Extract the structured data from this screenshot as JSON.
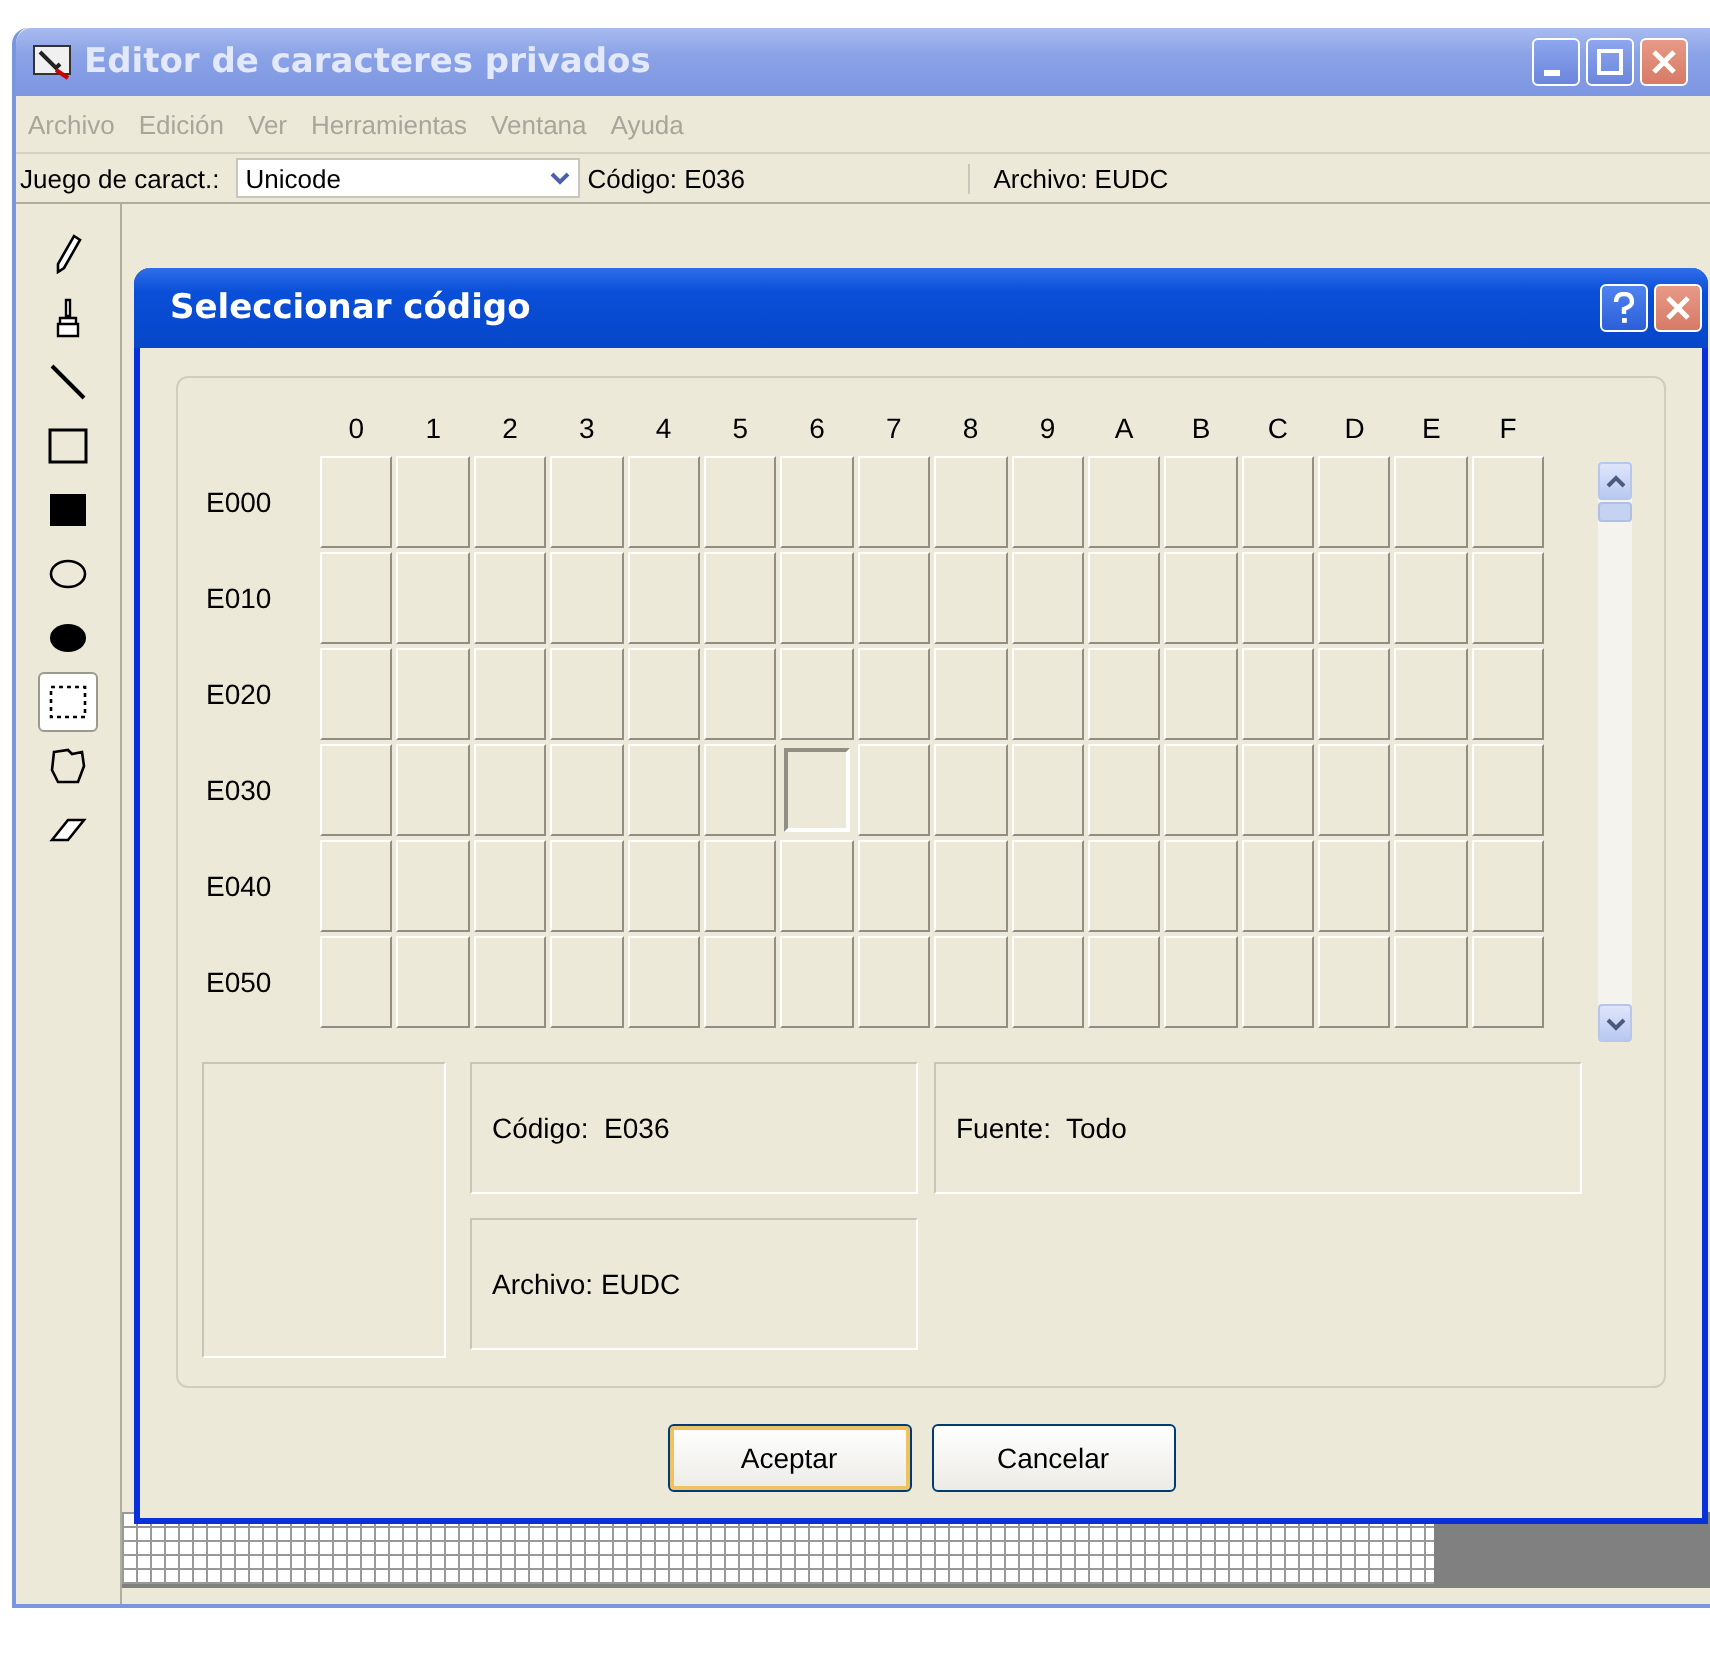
{
  "window": {
    "title": "Editor de caracteres privados"
  },
  "menu": [
    "Archivo",
    "Edición",
    "Ver",
    "Herramientas",
    "Ventana",
    "Ayuda"
  ],
  "toolbar": {
    "charset_label": "Juego de caract.:",
    "charset_value": "Unicode",
    "code": "Código: E036",
    "file": "Archivo: EUDC"
  },
  "tools": [
    {
      "kind": "pencil",
      "selected": false
    },
    {
      "kind": "brush",
      "selected": false
    },
    {
      "kind": "line",
      "selected": false
    },
    {
      "kind": "rect",
      "selected": false
    },
    {
      "kind": "filled-rect",
      "selected": false
    },
    {
      "kind": "ellipse",
      "selected": false
    },
    {
      "kind": "filled-ellipse",
      "selected": false
    },
    {
      "kind": "rect-select",
      "selected": true
    },
    {
      "kind": "free-select",
      "selected": false
    },
    {
      "kind": "eraser",
      "selected": false
    }
  ],
  "dialog": {
    "title": "Seleccionar código",
    "columns": [
      "0",
      "1",
      "2",
      "3",
      "4",
      "5",
      "6",
      "7",
      "8",
      "9",
      "A",
      "B",
      "C",
      "D",
      "E",
      "F"
    ],
    "rows": [
      {
        "label": "E000",
        "cells": [
          {
            "selected": false
          },
          {
            "selected": false
          },
          {
            "selected": false
          },
          {
            "selected": false
          },
          {
            "selected": false
          },
          {
            "selected": false
          },
          {
            "selected": false
          },
          {
            "selected": false
          },
          {
            "selected": false
          },
          {
            "selected": false
          },
          {
            "selected": false
          },
          {
            "selected": false
          },
          {
            "selected": false
          },
          {
            "selected": false
          },
          {
            "selected": false
          },
          {
            "selected": false
          }
        ]
      },
      {
        "label": "E010",
        "cells": [
          {
            "selected": false
          },
          {
            "selected": false
          },
          {
            "selected": false
          },
          {
            "selected": false
          },
          {
            "selected": false
          },
          {
            "selected": false
          },
          {
            "selected": false
          },
          {
            "selected": false
          },
          {
            "selected": false
          },
          {
            "selected": false
          },
          {
            "selected": false
          },
          {
            "selected": false
          },
          {
            "selected": false
          },
          {
            "selected": false
          },
          {
            "selected": false
          },
          {
            "selected": false
          }
        ]
      },
      {
        "label": "E020",
        "cells": [
          {
            "selected": false
          },
          {
            "selected": false
          },
          {
            "selected": false
          },
          {
            "selected": false
          },
          {
            "selected": false
          },
          {
            "selected": false
          },
          {
            "selected": false
          },
          {
            "selected": false
          },
          {
            "selected": false
          },
          {
            "selected": false
          },
          {
            "selected": false
          },
          {
            "selected": false
          },
          {
            "selected": false
          },
          {
            "selected": false
          },
          {
            "selected": false
          },
          {
            "selected": false
          }
        ]
      },
      {
        "label": "E030",
        "cells": [
          {
            "selected": false
          },
          {
            "selected": false
          },
          {
            "selected": false
          },
          {
            "selected": false
          },
          {
            "selected": false
          },
          {
            "selected": false
          },
          {
            "selected": true
          },
          {
            "selected": false
          },
          {
            "selected": false
          },
          {
            "selected": false
          },
          {
            "selected": false
          },
          {
            "selected": false
          },
          {
            "selected": false
          },
          {
            "selected": false
          },
          {
            "selected": false
          },
          {
            "selected": false
          }
        ]
      },
      {
        "label": "E040",
        "cells": [
          {
            "selected": false
          },
          {
            "selected": false
          },
          {
            "selected": false
          },
          {
            "selected": false
          },
          {
            "selected": false
          },
          {
            "selected": false
          },
          {
            "selected": false
          },
          {
            "selected": false
          },
          {
            "selected": false
          },
          {
            "selected": false
          },
          {
            "selected": false
          },
          {
            "selected": false
          },
          {
            "selected": false
          },
          {
            "selected": false
          },
          {
            "selected": false
          },
          {
            "selected": false
          }
        ]
      },
      {
        "label": "E050",
        "cells": [
          {
            "selected": false
          },
          {
            "selected": false
          },
          {
            "selected": false
          },
          {
            "selected": false
          },
          {
            "selected": false
          },
          {
            "selected": false
          },
          {
            "selected": false
          },
          {
            "selected": false
          },
          {
            "selected": false
          },
          {
            "selected": false
          },
          {
            "selected": false
          },
          {
            "selected": false
          },
          {
            "selected": false
          },
          {
            "selected": false
          },
          {
            "selected": false
          },
          {
            "selected": false
          }
        ]
      }
    ],
    "code": "Código:  E036",
    "font": "Fuente:  Todo",
    "file": "Archivo: EUDC",
    "buttons": [
      {
        "label": "Aceptar",
        "default": true
      },
      {
        "label": "Cancelar",
        "default": false
      }
    ]
  }
}
